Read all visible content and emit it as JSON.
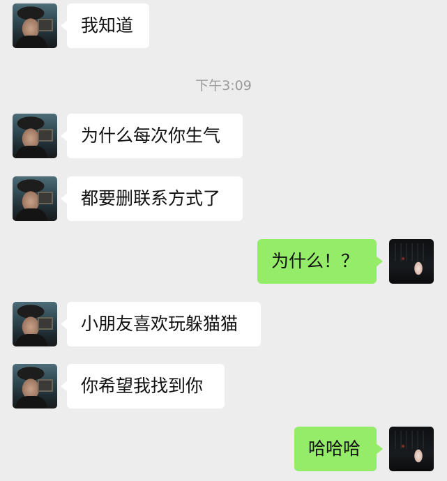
{
  "colors": {
    "background": "#ededed",
    "incoming_bubble": "#ffffff",
    "outgoing_bubble": "#95ec69",
    "timestamp_text": "#9a9a9a"
  },
  "timestamp": "下午3:09",
  "messages": [
    {
      "sender": "friend",
      "text": "我知道"
    },
    {
      "sender": "friend",
      "text": "为什么每次你生气"
    },
    {
      "sender": "friend",
      "text": "都要删联系方式了"
    },
    {
      "sender": "me",
      "text": "为什么！？"
    },
    {
      "sender": "friend",
      "text": "小朋友喜欢玩躲猫猫"
    },
    {
      "sender": "friend",
      "text": "你希望我找到你"
    },
    {
      "sender": "me",
      "text": "哈哈哈"
    }
  ]
}
